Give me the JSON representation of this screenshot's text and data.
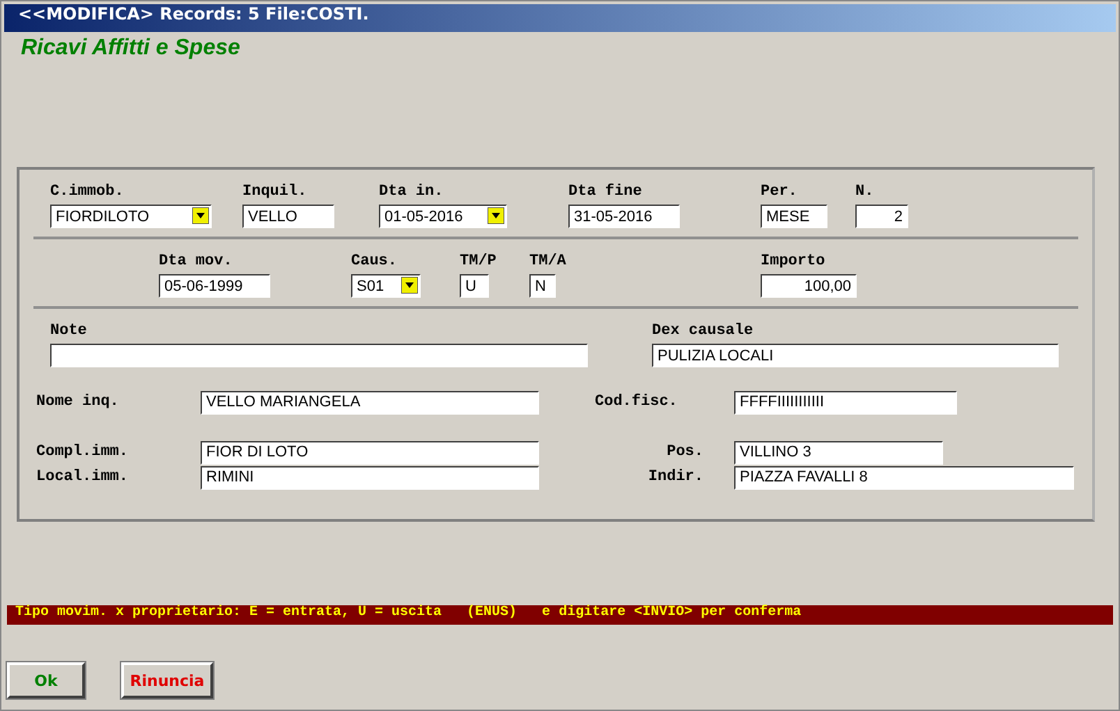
{
  "window": {
    "title": "<<MODIFICA> Records: 5  File:COSTI."
  },
  "heading": "Ricavi Affitti e Spese",
  "row_1": [
    {
      "label": "C.immob.",
      "value": "FIORDILOTO",
      "kind": "combo"
    },
    {
      "label": "Inquil.",
      "value": "VELLO",
      "kind": "text"
    },
    {
      "label": "Dta in.",
      "value": "01-05-2016",
      "kind": "combo"
    },
    {
      "label": "Dta fine",
      "value": "31-05-2016",
      "kind": "text"
    },
    {
      "label": "Per.",
      "value": "MESE",
      "kind": "text"
    },
    {
      "label": "N.",
      "value": "2",
      "kind": "number"
    }
  ],
  "row_2": [
    {
      "label": "Dta mov.",
      "value": "05-06-1999",
      "kind": "text"
    },
    {
      "label": "Caus.",
      "value": "S01",
      "kind": "combo"
    },
    {
      "label": "TM/P",
      "value": "U",
      "kind": "text"
    },
    {
      "label": "TM/A",
      "value": "N",
      "kind": "text"
    },
    {
      "label": "Importo",
      "value": "100,00",
      "kind": "number"
    }
  ],
  "row_3": [
    {
      "label": "Note"
    },
    {
      "label": "Dex causale",
      "value": "PULIZIA LOCALI"
    }
  ],
  "details": [
    {
      "label": "Nome inq.",
      "value": "VELLO MARIANGELA",
      "label_2": "Cod.fisc.",
      "value_2": "FFFFIIIIIIIIIII"
    },
    {
      "label": "Compl.imm.",
      "value": "FIOR DI LOTO",
      "label_2": "Pos.",
      "value_2": "VILLINO 3"
    },
    {
      "label": "Local.imm.",
      "value": "RIMINI",
      "label_2": "Indir.",
      "value_2": "PIAZZA FAVALLI 8"
    }
  ],
  "status_bar": "Tipo movim. x proprietario: E = entrata, U = uscita   (ENUS)   e digitare <INVIO> per conferma",
  "buttons": [
    {
      "label": "Ok",
      "kind": "ok"
    },
    {
      "label": "Rinuncia",
      "kind": "cancel"
    }
  ]
}
